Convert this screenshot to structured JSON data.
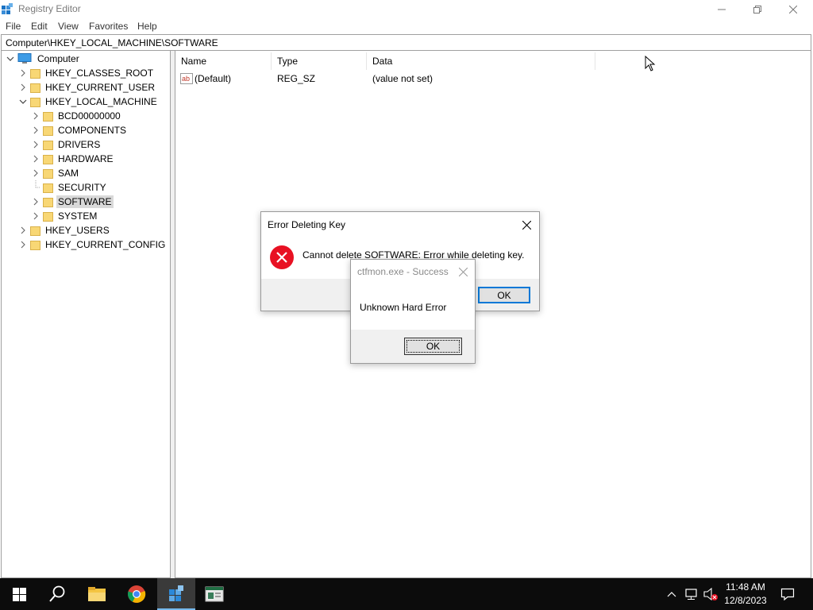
{
  "window": {
    "title": "Registry Editor"
  },
  "menu": [
    "File",
    "Edit",
    "View",
    "Favorites",
    "Help"
  ],
  "address": "Computer\\HKEY_LOCAL_MACHINE\\SOFTWARE",
  "tree": {
    "root": "Computer",
    "hives": [
      "HKEY_CLASSES_ROOT",
      "HKEY_CURRENT_USER",
      "HKEY_LOCAL_MACHINE",
      "HKEY_USERS",
      "HKEY_CURRENT_CONFIG"
    ],
    "hklm_children": [
      "BCD00000000",
      "COMPONENTS",
      "DRIVERS",
      "HARDWARE",
      "SAM",
      "SECURITY",
      "SOFTWARE",
      "SYSTEM"
    ],
    "selected": "SOFTWARE"
  },
  "list": {
    "columns": [
      "Name",
      "Type",
      "Data"
    ],
    "rows": [
      {
        "name": "(Default)",
        "type": "REG_SZ",
        "data": "(value not set)",
        "icon": "string-value-icon"
      }
    ]
  },
  "error_dialog": {
    "title": "Error Deleting Key",
    "message": "Cannot delete SOFTWARE:  Error while deleting key.",
    "ok_label": "OK",
    "icon": "error-icon"
  },
  "ctfmon_dialog": {
    "title": "ctfmon.exe - Success",
    "message": "Unknown Hard Error",
    "ok_label": "OK"
  },
  "taskbar": {
    "apps": [
      "start-icon",
      "search-icon",
      "file-explorer-icon",
      "chrome-icon",
      "regedit-icon",
      "app-window-icon"
    ],
    "active_app": "regedit-icon",
    "clock_time": "11:48 AM",
    "clock_date": "12/8/2023"
  },
  "colors": {
    "accent": "#0078d7",
    "taskbar": "#0c0c0c",
    "folder": "#f8d775",
    "error_red": "#e81123"
  }
}
